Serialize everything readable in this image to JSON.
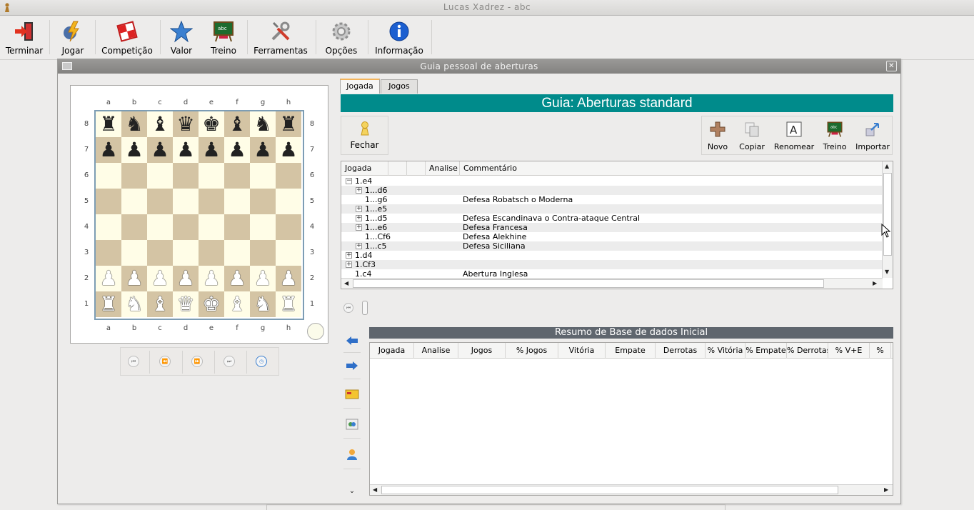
{
  "window": {
    "title": "Lucas Xadrez - abc"
  },
  "toolbar": {
    "items": [
      {
        "label": "Terminar",
        "icon": "exit-door-icon"
      },
      {
        "label": "Jogar",
        "icon": "play-bolt-icon"
      },
      {
        "label": "Competição",
        "icon": "competition-board-icon"
      },
      {
        "label": "Valor",
        "icon": "star-icon"
      },
      {
        "label": "Treino",
        "icon": "training-board-icon"
      },
      {
        "label": "Ferramentas",
        "icon": "tools-icon"
      },
      {
        "label": "Opções",
        "icon": "gear-icon"
      },
      {
        "label": "Informação",
        "icon": "info-icon"
      }
    ]
  },
  "dialog": {
    "title": "Guia pessoal de aberturas",
    "close_glyph": "✕"
  },
  "board": {
    "files": [
      "a",
      "b",
      "c",
      "d",
      "e",
      "f",
      "g",
      "h"
    ],
    "ranks": [
      "8",
      "7",
      "6",
      "5",
      "4",
      "3",
      "2",
      "1"
    ],
    "position": [
      "rnbqkbnr",
      "pppppppp",
      "........",
      "........",
      "........",
      "........",
      "PPPPPPPP",
      "RNBQKBNR"
    ]
  },
  "tabs": [
    {
      "label": "Jogada",
      "active": true
    },
    {
      "label": "Jogos",
      "active": false
    }
  ],
  "guide": {
    "title": "Guia: Aberturas standard",
    "close_label": "Fechar",
    "actions": [
      {
        "label": "Novo",
        "icon": "plus-icon"
      },
      {
        "label": "Copiar",
        "icon": "copy-icon"
      },
      {
        "label": "Renomear",
        "icon": "rename-icon"
      },
      {
        "label": "Treino",
        "icon": "training-board-icon"
      },
      {
        "label": "Importar",
        "icon": "import-icon"
      }
    ]
  },
  "tree": {
    "columns": [
      "Jogada",
      "",
      "",
      "Analise",
      "Commentário"
    ],
    "rows": [
      {
        "move": "1.e4",
        "comment": "",
        "level": 0,
        "expander": "−"
      },
      {
        "move": "1...d6",
        "comment": "",
        "level": 1,
        "expander": "+"
      },
      {
        "move": "1...g6",
        "comment": "Defesa Robatsch o Moderna",
        "level": 1,
        "expander": ""
      },
      {
        "move": "1...e5",
        "comment": "",
        "level": 1,
        "expander": "+"
      },
      {
        "move": "1...d5",
        "comment": "Defesa Escandinava o Contra-ataque Central",
        "level": 1,
        "expander": "+"
      },
      {
        "move": "1...e6",
        "comment": "Defesa Francesa",
        "level": 1,
        "expander": "+"
      },
      {
        "move": "1...Cf6",
        "comment": "Defesa Alekhine",
        "level": 1,
        "expander": ""
      },
      {
        "move": "1...c5",
        "comment": "Defesa Siciliana",
        "level": 1,
        "expander": "+"
      },
      {
        "move": "1.d4",
        "comment": "",
        "level": 0,
        "expander": "+"
      },
      {
        "move": "1.Cf3",
        "comment": "",
        "level": 0,
        "expander": "+"
      },
      {
        "move": "1.c4",
        "comment": "Abertura Inglesa",
        "level": 0,
        "expander": ""
      }
    ]
  },
  "summary": {
    "title": "Resumo de Base de dados Inicial",
    "columns": [
      "Jogada",
      "Analise",
      "Jogos",
      "% Jogos",
      "Vitória",
      "Empate",
      "Derrotas",
      "% Vitória",
      "% Empate",
      "% Derrotas",
      "% V+E",
      "%"
    ]
  },
  "side_tools": [
    {
      "icon": "arrow-left-icon"
    },
    {
      "icon": "arrow-right-icon"
    },
    {
      "icon": "card-icon"
    },
    {
      "icon": "database-icon"
    },
    {
      "icon": "person-icon"
    },
    {
      "icon": "chevron-double-down-icon"
    }
  ]
}
